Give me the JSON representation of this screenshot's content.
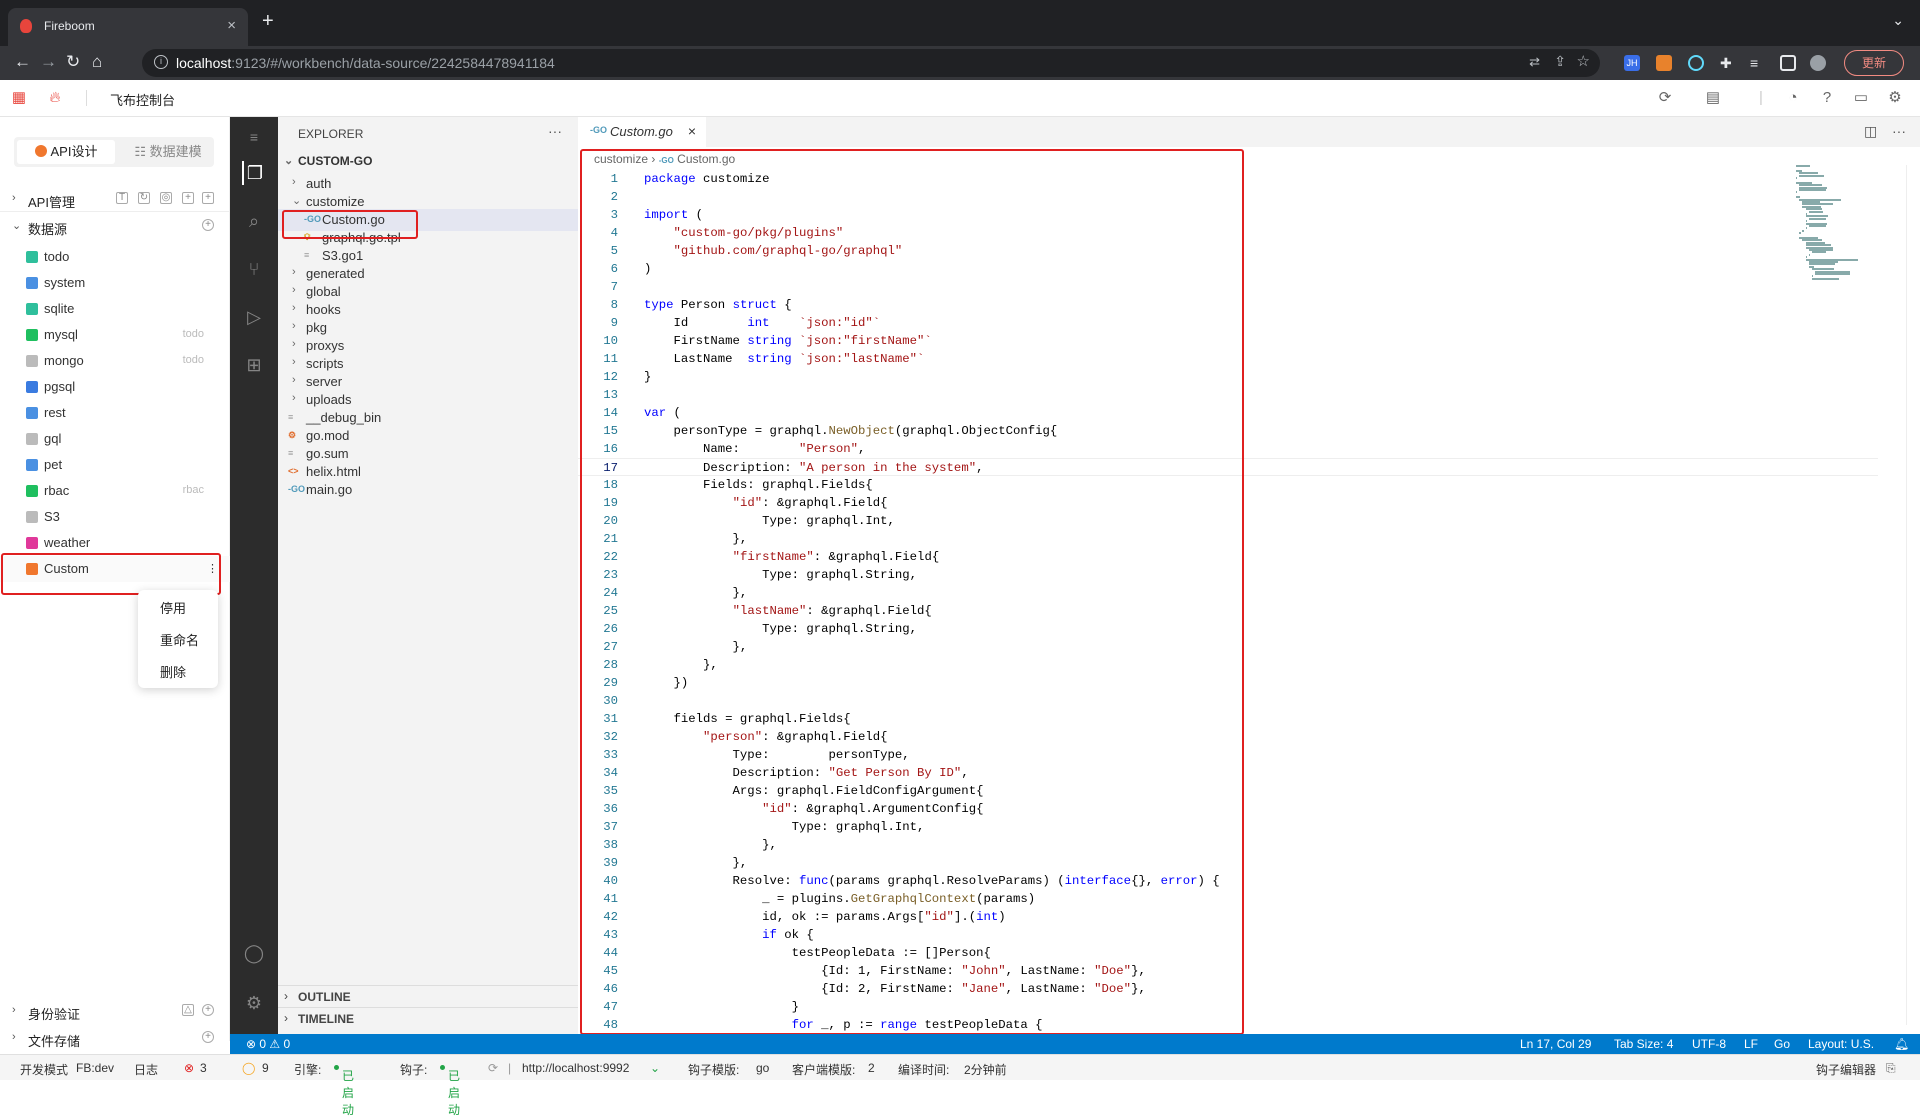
{
  "browser": {
    "tab_title": "Fireboom",
    "new_tab": "+",
    "url_host": "localhost",
    "url_rest": ":9123/#/workbench/data-source/2242584478941184",
    "update_label": "更新",
    "ext_badge": "JH"
  },
  "app": {
    "title": "飞布控制台",
    "seg_api": "API设计",
    "seg_data": "数据建模"
  },
  "left": {
    "api_mgmt": "API管理",
    "datasource": "数据源",
    "items": [
      {
        "name": "todo",
        "tag": "",
        "color": "#2fbf9c"
      },
      {
        "name": "system",
        "tag": "",
        "color": "#4a90e2"
      },
      {
        "name": "sqlite",
        "tag": "",
        "color": "#2fbf9c"
      },
      {
        "name": "mysql",
        "tag": "todo",
        "color": "#1fbf5f"
      },
      {
        "name": "mongo",
        "tag": "todo",
        "color": "#bbbbbb"
      },
      {
        "name": "pgsql",
        "tag": "",
        "color": "#3a7be0"
      },
      {
        "name": "rest",
        "tag": "",
        "color": "#4a90e2"
      },
      {
        "name": "gql",
        "tag": "",
        "color": "#bbbbbb"
      },
      {
        "name": "pet",
        "tag": "",
        "color": "#4a90e2"
      },
      {
        "name": "rbac",
        "tag": "rbac",
        "color": "#1fbf5f"
      },
      {
        "name": "S3",
        "tag": "",
        "color": "#bbbbbb"
      },
      {
        "name": "weather",
        "tag": "",
        "color": "#e0389a"
      },
      {
        "name": "Custom",
        "tag": "",
        "color": "#f0772e"
      }
    ],
    "context_menu": [
      "停用",
      "重命名",
      "删除"
    ],
    "auth": "身份验证",
    "storage": "文件存储"
  },
  "explorer": {
    "header": "EXPLORER",
    "root": "CUSTOM-GO",
    "outline": "OUTLINE",
    "timeline": "TIMELINE",
    "tree": [
      {
        "name": "auth",
        "kind": "folder",
        "depth": 1,
        "open": false
      },
      {
        "name": "customize",
        "kind": "folder",
        "depth": 1,
        "open": true
      },
      {
        "name": "Custom.go",
        "kind": "go",
        "depth": 2
      },
      {
        "name": "graphql.go.tpl",
        "kind": "tpl",
        "depth": 2
      },
      {
        "name": "S3.go1",
        "kind": "txt",
        "depth": 2
      },
      {
        "name": "generated",
        "kind": "folder",
        "depth": 1,
        "open": false
      },
      {
        "name": "global",
        "kind": "folder",
        "depth": 1,
        "open": false
      },
      {
        "name": "hooks",
        "kind": "folder",
        "depth": 1,
        "open": false
      },
      {
        "name": "pkg",
        "kind": "folder",
        "depth": 1,
        "open": false
      },
      {
        "name": "proxys",
        "kind": "folder",
        "depth": 1,
        "open": false
      },
      {
        "name": "scripts",
        "kind": "folder",
        "depth": 1,
        "open": false
      },
      {
        "name": "server",
        "kind": "folder",
        "depth": 1,
        "open": false
      },
      {
        "name": "uploads",
        "kind": "folder",
        "depth": 1,
        "open": false
      },
      {
        "name": "__debug_bin",
        "kind": "txt",
        "depth": 1
      },
      {
        "name": "go.mod",
        "kind": "mod",
        "depth": 1
      },
      {
        "name": "go.sum",
        "kind": "txt",
        "depth": 1
      },
      {
        "name": "helix.html",
        "kind": "html",
        "depth": 1
      },
      {
        "name": "main.go",
        "kind": "go",
        "depth": 1
      }
    ]
  },
  "editor": {
    "tab": "Custom.go",
    "breadcrumb_folder": "customize",
    "breadcrumb_file": "Custom.go",
    "current_line": 17,
    "code": [
      "package customize",
      "",
      "import (",
      "    \"custom-go/pkg/plugins\"",
      "    \"github.com/graphql-go/graphql\"",
      ")",
      "",
      "type Person struct {",
      "    Id        int    `json:\"id\"`",
      "    FirstName string `json:\"firstName\"`",
      "    LastName  string `json:\"lastName\"`",
      "}",
      "",
      "var (",
      "    personType = graphql.NewObject(graphql.ObjectConfig{",
      "        Name:        \"Person\",",
      "        Description: \"A person in the system\",",
      "        Fields: graphql.Fields{",
      "            \"id\": &graphql.Field{",
      "                Type: graphql.Int,",
      "            },",
      "            \"firstName\": &graphql.Field{",
      "                Type: graphql.String,",
      "            },",
      "            \"lastName\": &graphql.Field{",
      "                Type: graphql.String,",
      "            },",
      "        },",
      "    })",
      "",
      "    fields = graphql.Fields{",
      "        \"person\": &graphql.Field{",
      "            Type:        personType,",
      "            Description: \"Get Person By ID\",",
      "            Args: graphql.FieldConfigArgument{",
      "                \"id\": &graphql.ArgumentConfig{",
      "                    Type: graphql.Int,",
      "                },",
      "            },",
      "            Resolve: func(params graphql.ResolveParams) (interface{}, error) {",
      "                _ = plugins.GetGraphqlContext(params)",
      "                id, ok := params.Args[\"id\"].(int)",
      "                if ok {",
      "                    testPeopleData := []Person{",
      "                        {Id: 1, FirstName: \"John\", LastName: \"Doe\"},",
      "                        {Id: 2, FirstName: \"Jane\", LastName: \"Doe\"},",
      "                    }",
      "                    for _, p := range testPeopleData {"
    ]
  },
  "vs_status": {
    "problems": "⊗ 0 ⚠ 0",
    "position": "Ln 17, Col 29",
    "tabsize": "Tab Size: 4",
    "encoding": "UTF-8",
    "eol": "LF",
    "lang": "Go",
    "layout": "Layout: U.S."
  },
  "app_status": {
    "mode": "开发模式",
    "env": "FB:dev",
    "log": "日志",
    "errors": "3",
    "warnings": "9",
    "engine_label": "引擎:",
    "engine_state": "已启动",
    "hook_label": "钩子:",
    "hook_state": "已启动",
    "hook_url": "http://localhost:9992",
    "hook_tpl_label": "钩子模版:",
    "hook_tpl": "go",
    "client_tpl_label": "客户端模版:",
    "client_tpl": "2",
    "compile_label": "编译时间:",
    "compile_time": "2分钟前",
    "hook_editor": "钩子编辑器"
  }
}
